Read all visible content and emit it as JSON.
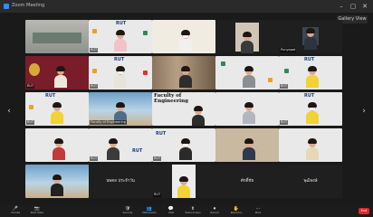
{
  "window": {
    "title": "Zoom Meeting",
    "controls": [
      "–",
      "▢",
      "✕"
    ]
  },
  "view_button": "Gallery View",
  "pager": {
    "left": "‹",
    "right": "›",
    "page": "1/2"
  },
  "tiles": [
    {
      "label": ""
    },
    {
      "label": "RUT"
    },
    {
      "label": ""
    },
    {
      "label": ""
    },
    {
      "label": "Punyapat"
    },
    {
      "label": "RUT"
    },
    {
      "label": "RUT"
    },
    {
      "label": ""
    },
    {
      "label": ""
    },
    {
      "label": "RUT"
    },
    {
      "label": "RUT"
    },
    {
      "label": "Faculty of Engineering"
    },
    {
      "label": ""
    },
    {
      "label": ""
    },
    {
      "label": "RUT"
    },
    {
      "label": ""
    },
    {
      "label": "RUT"
    },
    {
      "label": "RUT"
    },
    {
      "label": ""
    },
    {
      "label": ""
    },
    {
      "label": ""
    },
    {
      "label": "ศุภชัย"
    },
    {
      "label": "RUT"
    },
    {
      "label": ""
    },
    {
      "label": ""
    },
    {
      "label": ""
    },
    {
      "label": "นพดล ประจำวัน"
    },
    {
      "label": "ศักดิ์ชัย"
    },
    {
      "label": "พุฒิพงษ์"
    },
    {
      "label": "Dr."
    }
  ],
  "screen_strip": "ประชุมคณะกรรมการ",
  "toolbar": {
    "items": [
      {
        "icon": "🎤",
        "label": "Unmute"
      },
      {
        "icon": "📷",
        "label": "Start Video"
      },
      {
        "icon": "🛡",
        "label": "Security"
      },
      {
        "icon": "👥",
        "label": "Participants"
      },
      {
        "icon": "💬",
        "label": "Chat"
      },
      {
        "icon": "⬆",
        "label": "Share Screen"
      },
      {
        "icon": "⏺",
        "label": "Record"
      },
      {
        "icon": "✋",
        "label": "Reactions"
      },
      {
        "icon": "⋯",
        "label": "More"
      }
    ],
    "end_label": "End"
  }
}
